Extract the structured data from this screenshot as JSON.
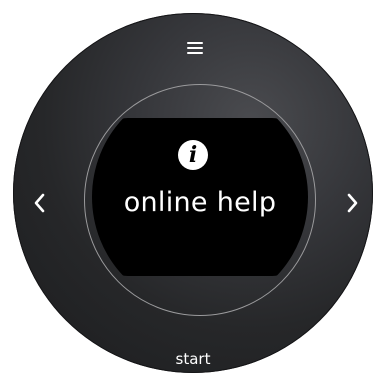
{
  "screen": {
    "title": "online help",
    "icon": "info-icon",
    "icon_glyph": "i"
  },
  "controls": {
    "menu": "menu-icon",
    "previous": "chevron-left-icon",
    "next": "chevron-right-icon",
    "start_label": "start"
  },
  "colors": {
    "dial": "#2b2c2f",
    "screen": "#000000",
    "text": "#ffffff",
    "ring": "#9a9a9c"
  }
}
